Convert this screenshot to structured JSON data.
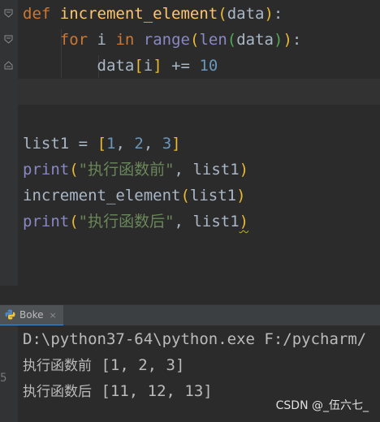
{
  "code": {
    "l1": {
      "kw": "def",
      "name": "increment_element",
      "param": "data",
      "colon": ":"
    },
    "l2": {
      "kw": "for",
      "var": "i",
      "in": "in",
      "range": "range",
      "len": "len",
      "arg": "data",
      "colon": ":"
    },
    "l3": {
      "target": "data",
      "index": "i",
      "op": "+=",
      "num": "10"
    },
    "l5": {
      "name": "list1",
      "eq": "=",
      "n1": "1",
      "n2": "2",
      "n3": "3"
    },
    "l6": {
      "fn": "print",
      "str": "\"执行函数前\"",
      "arg": "list1"
    },
    "l7": {
      "fn": "increment_element",
      "arg": "list1"
    },
    "l8": {
      "fn": "print",
      "str": "\"执行函数后\"",
      "arg": "list1"
    }
  },
  "run_panel": {
    "tab_label": "Boke",
    "close_glyph": "×",
    "icon": "python-icon"
  },
  "console": {
    "line1": "D:\\python37-64\\python.exe F:/pycharm/",
    "line2_label": "执行函数前",
    "line2_value": " [1, 2, 3]",
    "line3_label": "执行函数后",
    "line3_value": " [11, 12, 13]"
  },
  "side_digit": "5",
  "watermark": "CSDN @_伍六七_"
}
